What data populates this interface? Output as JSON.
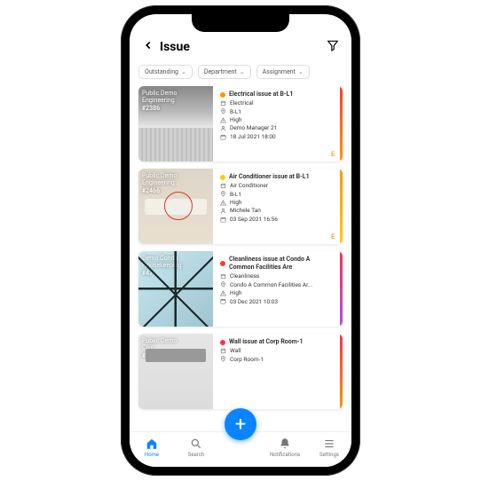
{
  "header": {
    "title": "Issue"
  },
  "filters": [
    {
      "label": "Outstanding"
    },
    {
      "label": "Department"
    },
    {
      "label": "Assignment"
    }
  ],
  "cards": [
    {
      "overlay_line1": "Public Demo",
      "overlay_line2": "Engineering",
      "overlay_ref": "#2386",
      "status_color": "#ff9500",
      "title": "Electrical issue at B-L1",
      "category": "Electrical",
      "location": "B-L1",
      "priority": "High",
      "assignee": "Demo Manager 21",
      "date": "18 Jul 2021 18:00",
      "badge": "E",
      "stripe_class": "stripe1",
      "thumb_class": "thumb1"
    },
    {
      "overlay_line1": "Public Demo",
      "overlay_line2": "Engineering",
      "overlay_ref": "#2466",
      "status_color": "#ffcc00",
      "title": "Air Conditioner issue at B-L1",
      "category": "Air Conditioner",
      "location": "B-L1",
      "priority": "High",
      "assignee": "Michele Tan",
      "date": "03 Sep 2021 16:56",
      "badge": "E",
      "stripe_class": "stripe2",
      "thumb_class": "thumb2"
    },
    {
      "overlay_line1": "Demo Condo",
      "overlay_line2": "Housekeeping",
      "overlay_ref": "#47",
      "status_color": "#ff3b30",
      "title": "Cleanliness issue at Condo A Common Facilities Are",
      "category": "Cleanliness",
      "location": "Condo A Common Facilities Ar...",
      "priority": "High",
      "assignee": "",
      "date": "03 Dec 2021 10:03",
      "badge": "",
      "stripe_class": "stripe3",
      "thumb_class": "thumb3"
    },
    {
      "overlay_line1": "Public Demo",
      "overlay_line2": "Civil",
      "overlay_ref": "#2454",
      "status_color": "#ff2d55",
      "title": "Wall issue at Corp Room-1",
      "category": "Wall",
      "location": "Corp Room-1",
      "priority": "",
      "assignee": "",
      "date": "",
      "badge": "",
      "stripe_class": "stripe4",
      "thumb_class": "thumb4"
    }
  ],
  "tabs": [
    {
      "label": "Home",
      "active": true
    },
    {
      "label": "Search",
      "active": false
    },
    {
      "label": "",
      "active": false
    },
    {
      "label": "Notifications",
      "active": false
    },
    {
      "label": "Settings",
      "active": false
    }
  ]
}
